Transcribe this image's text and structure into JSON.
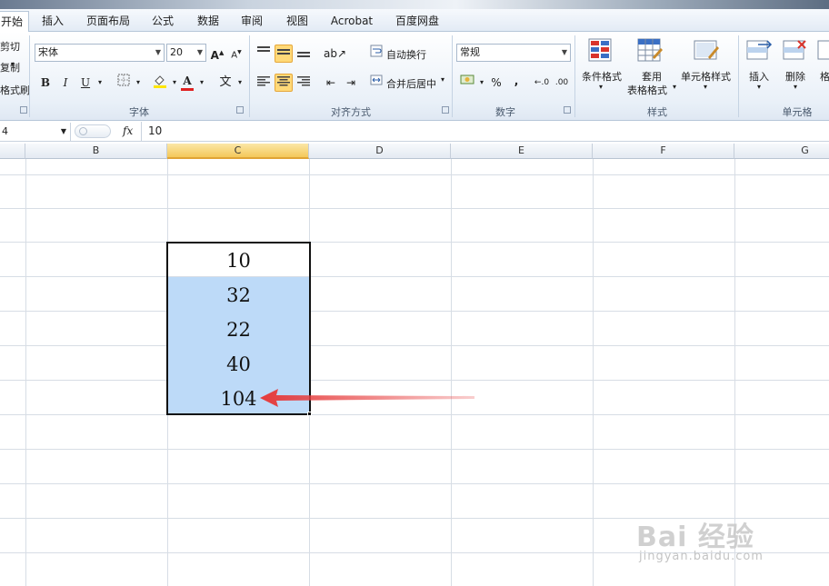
{
  "ribbon": {
    "tabs": [
      "开始",
      "插入",
      "页面布局",
      "公式",
      "数据",
      "审阅",
      "视图",
      "Acrobat",
      "百度网盘"
    ],
    "clipboard": {
      "cut": "剪切",
      "copy": "复制",
      "format_painter": "格式刷"
    },
    "font": {
      "name": "宋体",
      "size": "20",
      "group_label": "字体",
      "bold": "B",
      "italic": "I",
      "underline": "U"
    },
    "alignment": {
      "wrap_text": "自动换行",
      "merge_center": "合并后居中",
      "group_label": "对齐方式"
    },
    "number": {
      "format": "常规",
      "percent": "%",
      "comma": ",",
      "group_label": "数字"
    },
    "styles": {
      "conditional": "条件格式",
      "table_format_1": "套用",
      "table_format_2": "表格格式",
      "cell_styles": "单元格样式",
      "group_label": "样式"
    },
    "cells": {
      "insert": "插入",
      "delete": "删除",
      "format": "格",
      "group_label": "单元格"
    }
  },
  "formula_bar": {
    "name_box": "4",
    "fx": "fx",
    "value": "10"
  },
  "columns": [
    "B",
    "C",
    "D",
    "E",
    "F",
    "G"
  ],
  "cells": [
    "10",
    "32",
    "22",
    "40",
    "104"
  ],
  "watermark": {
    "logo": "Bai 经验",
    "url": "jingyan.baidu.com"
  },
  "colors": {
    "selection_fill": "#bddaf8",
    "arrow": "#e63b3b",
    "active_header": "#f4c85a"
  }
}
